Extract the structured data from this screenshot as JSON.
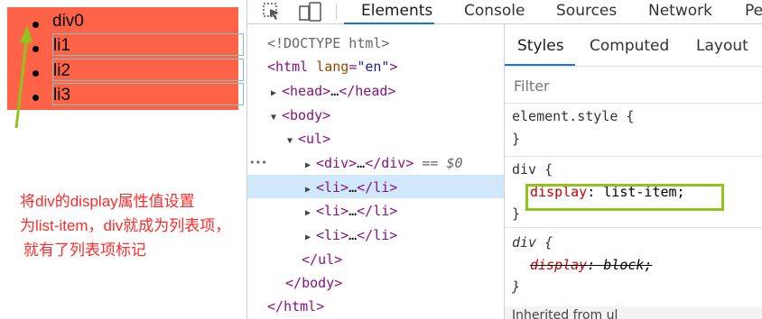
{
  "preview": {
    "list_items": [
      "div0",
      "li1",
      "li2",
      "li3"
    ],
    "annotation": [
      "将div的display属性值设置",
      "为list-item，div就成为列表项，",
      "就有了列表项标记"
    ]
  },
  "devtools": {
    "tabs": [
      "Elements",
      "Console",
      "Sources",
      "Network",
      "Pe"
    ],
    "active_tab": "Elements",
    "dom": {
      "doctype": "<!DOCTYPE html>",
      "html_open": "html",
      "lang_attr": "lang",
      "lang_val": "\"en\"",
      "head": "head",
      "body": "body",
      "ul": "ul",
      "div": "div",
      "li": "li",
      "ellipsis": "…",
      "selected_marker": "== $0",
      "dots": "•••"
    },
    "styles": {
      "tabs": [
        "Styles",
        "Computed",
        "Layout"
      ],
      "filter_placeholder": "Filter",
      "element_style": "element.style {",
      "close_brace": "}",
      "rule1_selector": "div {",
      "rule1_prop": "display",
      "rule1_value": "list-item;",
      "rule2_selector": "div {",
      "rule2_prop": "display",
      "rule2_value": "block;",
      "inherited": "Inherited from ul"
    }
  }
}
